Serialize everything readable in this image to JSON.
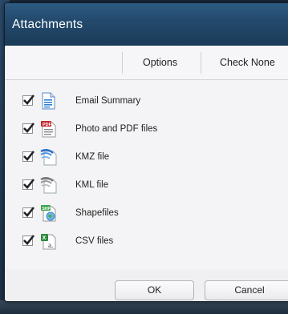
{
  "dialog": {
    "title": "Attachments"
  },
  "toolbar": {
    "options_label": "Options",
    "check_none_label": "Check None"
  },
  "attachments": [
    {
      "label": "Email Summary",
      "checked": true,
      "icon": "document-icon"
    },
    {
      "label": "Photo and PDF files",
      "checked": true,
      "icon": "pdf-icon"
    },
    {
      "label": "KMZ file",
      "checked": true,
      "icon": "kmz-file-icon"
    },
    {
      "label": "KML file",
      "checked": true,
      "icon": "kml-file-icon"
    },
    {
      "label": "Shapefiles",
      "checked": true,
      "icon": "shapefile-icon"
    },
    {
      "label": "CSV files",
      "checked": true,
      "icon": "csv-file-icon"
    }
  ],
  "footer": {
    "ok_label": "OK",
    "cancel_label": "Cancel"
  },
  "colors": {
    "titlebar": "#234a6d",
    "dialog_bg": "#f4f4f6",
    "accent_blue": "#2f7fd0"
  }
}
